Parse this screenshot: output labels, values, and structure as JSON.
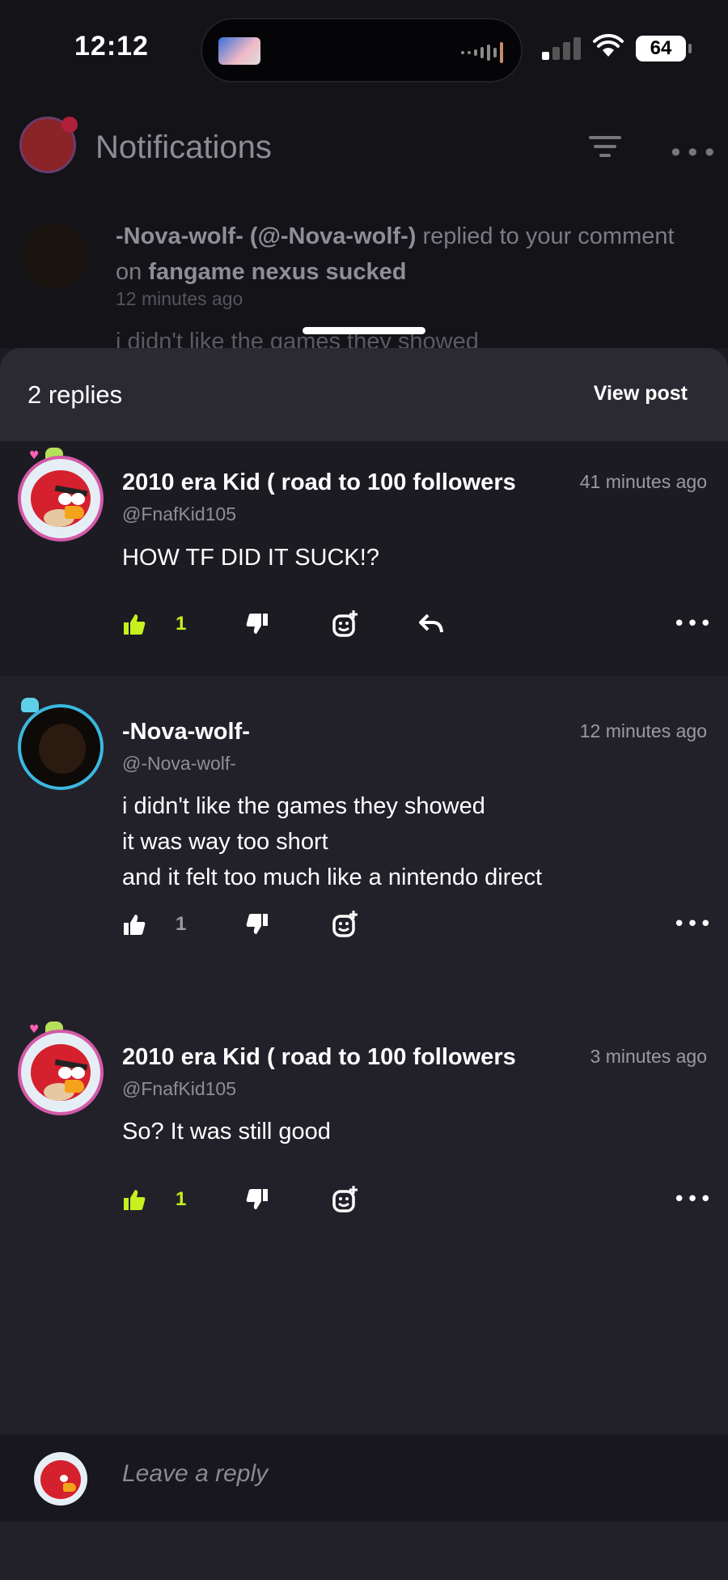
{
  "status_bar": {
    "time": "12:12",
    "battery": "64",
    "icons": [
      "signal-icon",
      "wifi-icon",
      "battery-icon"
    ]
  },
  "background": {
    "title": "Notifications",
    "notification": {
      "actor": "-Nova-wolf- (@-Nova-wolf-)",
      "action": " replied to your comment on ",
      "post": "fangame nexus sucked",
      "time": "12 minutes ago",
      "preview": "i didn't like the games they showed"
    }
  },
  "sheet": {
    "replies_count": "2 replies",
    "view_post": "View post"
  },
  "comments": [
    {
      "name": "2010 era Kid ( road to 100 followers",
      "handle": "@FnafKid105",
      "time": "41 minutes ago",
      "body": [
        "HOW TF DID IT SUCK!?"
      ],
      "likes": "1"
    },
    {
      "name": "-Nova-wolf-",
      "handle": "@-Nova-wolf-",
      "time": "12 minutes ago",
      "body": [
        "i didn't like the games they showed",
        "it was way too short",
        "and it felt too much like a nintendo direct"
      ],
      "likes": "1"
    },
    {
      "name": "2010 era Kid ( road to 100 followers",
      "handle": "@FnafKid105",
      "time": "3 minutes ago",
      "body": [
        "So? It was still good"
      ],
      "likes": "1"
    }
  ],
  "reply_bar": {
    "placeholder": "Leave a reply"
  },
  "colors": {
    "accent_like": "#c6f01e",
    "background": "#222129",
    "header": "#2b2a33"
  }
}
